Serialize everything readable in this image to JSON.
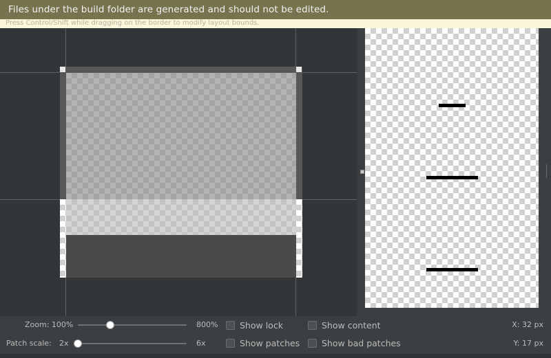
{
  "banner": {
    "warning": "Files under the build folder are generated and should not be edited.",
    "hint": "Press Control/Shift while dragging on the border to modify layout bounds."
  },
  "controls": {
    "zoom": {
      "label": "Zoom: 100%",
      "max_label": "800%",
      "value_fraction": 0.3
    },
    "patch_scale": {
      "label": "Patch scale:",
      "min_label": "2x",
      "max_label": "6x",
      "value_fraction": 0.0
    },
    "show_lock": {
      "label": "Show lock",
      "checked": false
    },
    "show_content": {
      "label": "Show content",
      "checked": false
    },
    "show_patches": {
      "label": "Show patches",
      "checked": false
    },
    "show_bad_patches": {
      "label": "Show bad patches",
      "checked": false
    },
    "x_readout": "X: 32 px",
    "y_readout": "Y: 17 px"
  },
  "colors": {
    "warning_bg": "#76734e",
    "hint_bg": "#fbf7dc",
    "editor_bg": "#323638",
    "content_fill": "#4b4a4a"
  }
}
